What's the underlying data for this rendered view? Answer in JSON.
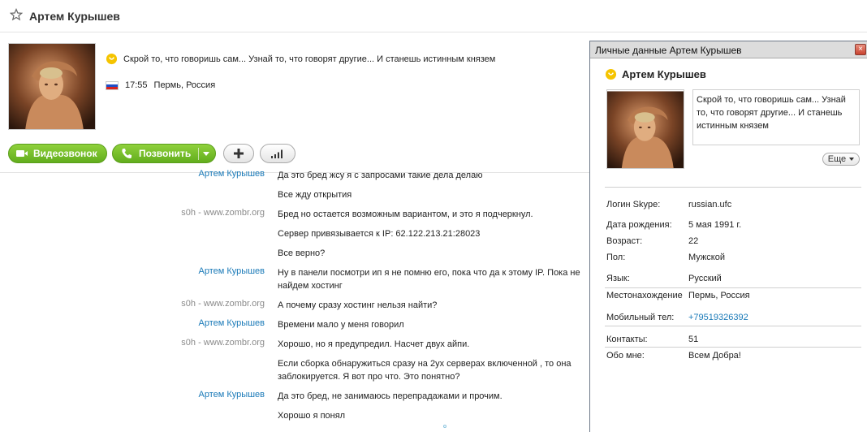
{
  "header": {
    "contact_name": "Артем Курышев"
  },
  "profile": {
    "mood": "Скрой то, что говоришь сам... Узнай то, что говорят другие... И станешь истинным князем",
    "local_time": "17:55",
    "location": "Пермь, Россия"
  },
  "buttons": {
    "video_call": "Видеозвонок",
    "call": "Позвонить"
  },
  "messages": [
    {
      "sender": "Артем Курышев",
      "sender_kind": "blue",
      "text": "Да это бред жсу я с запросами такие дела делаю"
    },
    {
      "sender": "",
      "sender_kind": "blue",
      "text": "Все жду открытия"
    },
    {
      "sender": "s0h - www.zombr.org",
      "sender_kind": "gray",
      "text": "Бред но остается возможным вариантом, и это я подчеркнул."
    },
    {
      "sender": "",
      "sender_kind": "gray",
      "text": "Сервер привязывается к IP: 62.122.213.21:28023"
    },
    {
      "sender": "",
      "sender_kind": "gray",
      "text": "Все верно?"
    },
    {
      "sender": "Артем Курышев",
      "sender_kind": "blue",
      "text": "Ну в панели посмотри ип я не помню его, пока что да к этому IP. Пока не найдем хостинг"
    },
    {
      "sender": "s0h - www.zombr.org",
      "sender_kind": "gray",
      "text": "А почему сразу хостинг нельзя найти?"
    },
    {
      "sender": "Артем Курышев",
      "sender_kind": "blue",
      "text": "Времени мало у меня говорил"
    },
    {
      "sender": "s0h - www.zombr.org",
      "sender_kind": "gray",
      "text": "Хорошо, но я предупредил. Насчет двух айпи."
    },
    {
      "sender": "",
      "sender_kind": "gray",
      "text": "Если сборка обнаружиться сразу на 2ух серверах включенной , то она заблокируется. Я вот про что. Это понятно?"
    },
    {
      "sender": "Артем Курышев",
      "sender_kind": "blue",
      "text": "Да это бред, не занимаюсь перепрадажами и прочим."
    },
    {
      "sender": "",
      "sender_kind": "blue",
      "text": "Хорошо я понял"
    }
  ],
  "personal_window": {
    "title": "Личные данные Артем Курышев",
    "name": "Артем Курышев",
    "mood": "Скрой то, что говоришь сам... Узнай то, что говорят другие... И станешь истинным князем",
    "more_button": "Еще",
    "fields": [
      {
        "label": "Логин Skype:",
        "value": "russian.ufc"
      },
      {
        "label": "Дата рождения:",
        "value": "5 мая 1991 г."
      },
      {
        "label": "Возраст:",
        "value": "22"
      },
      {
        "label": "Пол:",
        "value": "Мужской"
      },
      {
        "label": "Язык:",
        "value": "Русский"
      },
      {
        "label": "Местонахождение",
        "value": "Пермь, Россия"
      },
      {
        "label": "Мобильный тел:",
        "value": "+79519326392"
      },
      {
        "label": "Контакты:",
        "value": "51"
      },
      {
        "label": "Обо мне:",
        "value": "Всем Добра!"
      }
    ]
  },
  "colors": {
    "accent_green": "#6fbc22",
    "link_blue": "#1a7ab8",
    "skype_yellow": "#f5c400"
  },
  "icons": [
    "star-icon",
    "mood-icon",
    "russia-flag-icon",
    "video-icon",
    "phone-icon",
    "plus-icon",
    "signal-icon",
    "close-icon"
  ]
}
